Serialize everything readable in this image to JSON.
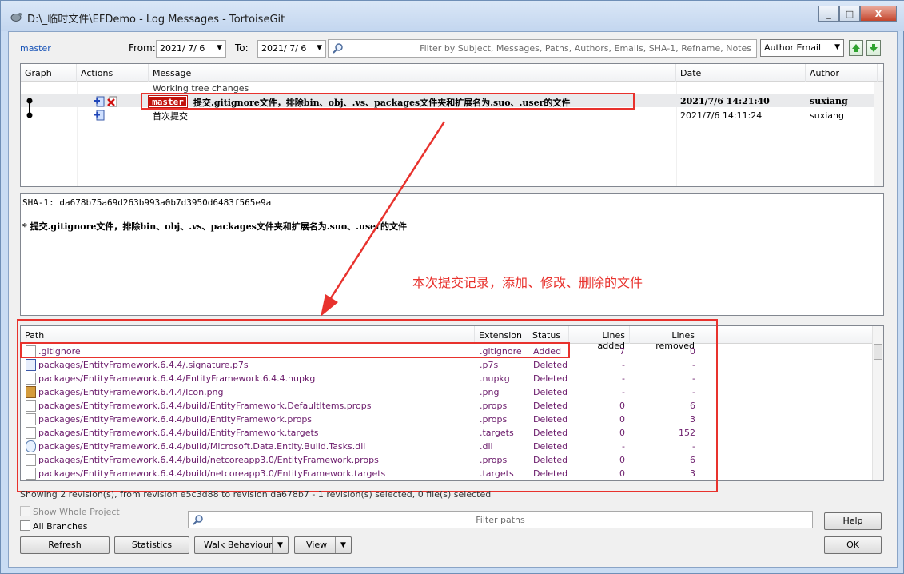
{
  "window": {
    "title": "D:\\_临时文件\\EFDemo - Log Messages - TortoiseGit",
    "minimize": "_",
    "maximize": "□",
    "close": "X"
  },
  "toolbar": {
    "branch_link": "master",
    "from_label": "From:",
    "from_date": "2021/ 7/ 6",
    "to_label": "To:",
    "to_date": "2021/ 7/ 6",
    "filter_placeholder": "Filter by Subject, Messages, Paths, Authors, Emails, SHA-1, Refname, Notes",
    "filter_field": "Author Email"
  },
  "log": {
    "columns": [
      "Graph",
      "Actions",
      "Message",
      "Date",
      "Author"
    ],
    "working_tree": "Working tree changes",
    "rows": [
      {
        "badge": "master",
        "message": "提交.gitignore文件，排除bin、obj、.vs、packages文件夹和扩展名为.suo、.user的文件",
        "date": "2021/7/6 14:21:40",
        "author": "suxiang"
      },
      {
        "message": "首次提交",
        "date": "2021/7/6 14:11:24",
        "author": "suxiang"
      }
    ]
  },
  "details": {
    "sha": "SHA-1: da678b75a69d263b993a0b7d3950d6483f565e9a",
    "message": "* 提交.gitignore文件，排除bin、obj、.vs、packages文件夹和扩展名为.suo、.user的文件",
    "annotation": "本次提交记录，添加、修改、删除的文件"
  },
  "files": {
    "columns": [
      "Path",
      "Extension",
      "Status",
      "Lines added",
      "Lines removed"
    ],
    "rows": [
      {
        "icon": "file-icon",
        "path": ".gitignore",
        "ext": ".gitignore",
        "status": "Added",
        "added": "7",
        "removed": "0"
      },
      {
        "icon": "certificate-icon",
        "path": "packages/EntityFramework.6.4.4/.signature.p7s",
        "ext": ".p7s",
        "status": "Deleted",
        "added": "-",
        "removed": "-"
      },
      {
        "icon": "file-icon",
        "path": "packages/EntityFramework.6.4.4/EntityFramework.6.4.4.nupkg",
        "ext": ".nupkg",
        "status": "Deleted",
        "added": "-",
        "removed": "-"
      },
      {
        "icon": "image-icon",
        "path": "packages/EntityFramework.6.4.4/Icon.png",
        "ext": ".png",
        "status": "Deleted",
        "added": "-",
        "removed": "-"
      },
      {
        "icon": "file-icon",
        "path": "packages/EntityFramework.6.4.4/build/EntityFramework.DefaultItems.props",
        "ext": ".props",
        "status": "Deleted",
        "added": "0",
        "removed": "6"
      },
      {
        "icon": "file-icon",
        "path": "packages/EntityFramework.6.4.4/build/EntityFramework.props",
        "ext": ".props",
        "status": "Deleted",
        "added": "0",
        "removed": "3"
      },
      {
        "icon": "file-icon",
        "path": "packages/EntityFramework.6.4.4/build/EntityFramework.targets",
        "ext": ".targets",
        "status": "Deleted",
        "added": "0",
        "removed": "152"
      },
      {
        "icon": "dll-icon",
        "path": "packages/EntityFramework.6.4.4/build/Microsoft.Data.Entity.Build.Tasks.dll",
        "ext": ".dll",
        "status": "Deleted",
        "added": "-",
        "removed": "-"
      },
      {
        "icon": "file-icon",
        "path": "packages/EntityFramework.6.4.4/build/netcoreapp3.0/EntityFramework.props",
        "ext": ".props",
        "status": "Deleted",
        "added": "0",
        "removed": "6"
      },
      {
        "icon": "file-icon",
        "path": "packages/EntityFramework.6.4.4/build/netcoreapp3.0/EntityFramework.targets",
        "ext": ".targets",
        "status": "Deleted",
        "added": "0",
        "removed": "3"
      }
    ]
  },
  "footer": {
    "status": "Showing 2 revision(s), from revision e5c3d88 to revision da678b7 - 1 revision(s) selected, 0 file(s) selected",
    "show_whole_project": "Show Whole Project",
    "all_branches": "All Branches",
    "filter_paths": "Filter paths",
    "help": "Help",
    "refresh": "Refresh",
    "statistics": "Statistics",
    "walk_behaviour": "Walk Behaviour",
    "view": "View",
    "ok": "OK"
  }
}
